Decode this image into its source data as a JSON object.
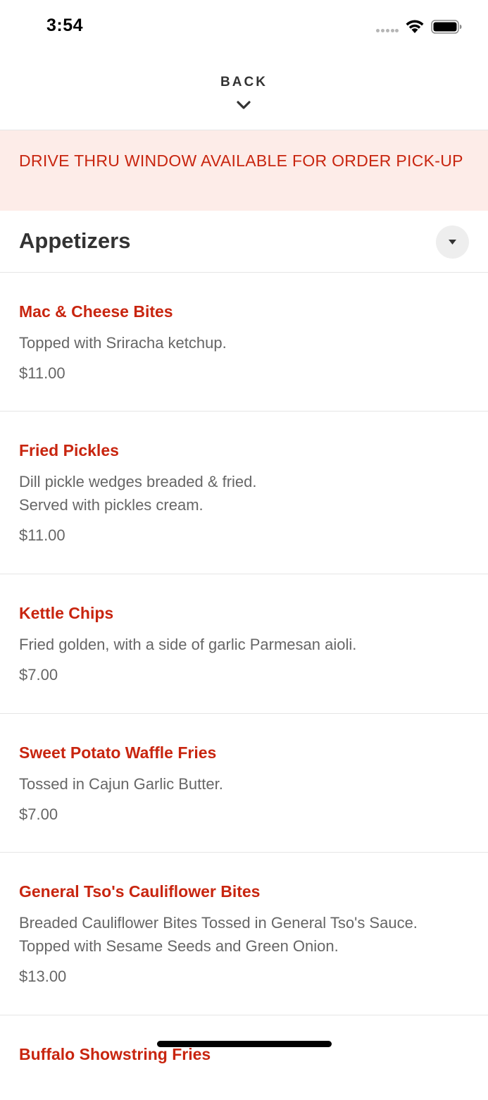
{
  "status_bar": {
    "time": "3:54"
  },
  "header": {
    "back_label": "BACK"
  },
  "banner": {
    "text": "DRIVE THRU WINDOW AVAILABLE FOR ORDER PICK-UP"
  },
  "section": {
    "title": "Appetizers"
  },
  "items": [
    {
      "name": "Mac & Cheese Bites",
      "description": "Topped with Sriracha ketchup.",
      "price": "$11.00"
    },
    {
      "name": "Fried Pickles",
      "description": "Dill pickle wedges breaded & fried.\nServed with pickles cream.",
      "price": "$11.00"
    },
    {
      "name": "Kettle Chips",
      "description": "Fried golden, with a side of garlic Parmesan aioli.",
      "price": "$7.00"
    },
    {
      "name": "Sweet Potato Waffle Fries",
      "description": "Tossed in Cajun Garlic Butter.",
      "price": "$7.00"
    },
    {
      "name": "General Tso's Cauliflower Bites",
      "description": "Breaded Cauliflower Bites Tossed in General Tso's Sauce.\nTopped with Sesame Seeds and Green Onion.",
      "price": "$13.00"
    },
    {
      "name": "Buffalo Showstring Fries",
      "description": "",
      "price": ""
    }
  ],
  "colors": {
    "accent": "#c8250f",
    "banner_bg": "#fdece8",
    "text_primary": "#333333",
    "text_secondary": "#666666",
    "divider": "#e6e6e6"
  },
  "icons": {
    "back": "chevron-down-icon",
    "section_toggle": "caret-down-icon",
    "wifi": "wifi-icon",
    "battery": "battery-icon",
    "signal": "cellular-signal-icon"
  }
}
